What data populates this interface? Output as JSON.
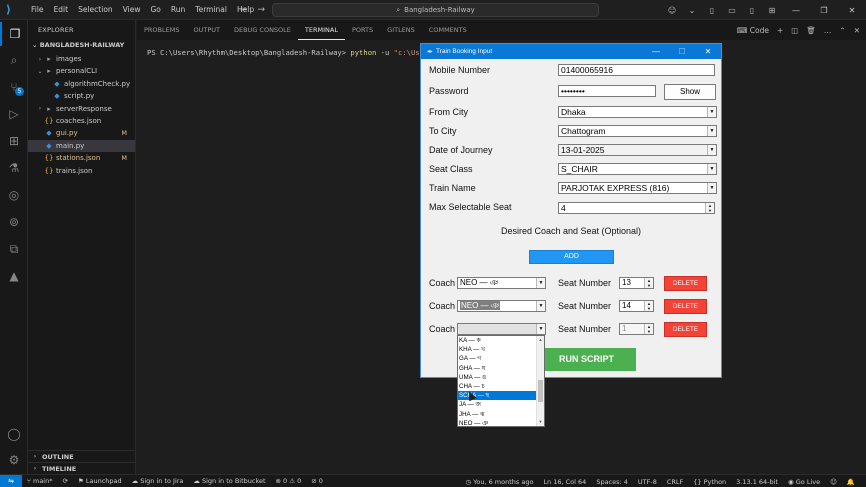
{
  "titlebar": {
    "menu": [
      "File",
      "Edit",
      "Selection",
      "View",
      "Go",
      "Run",
      "Terminal",
      "Help"
    ],
    "search_text": "Bangladesh-Railway"
  },
  "sidebar": {
    "title": "EXPLORER",
    "root": "BANGLADESH-RAILWAY",
    "items": [
      {
        "label": "images",
        "kind": "folder",
        "indent": 1,
        "expanded": false
      },
      {
        "label": "personalCLI",
        "kind": "folder",
        "indent": 1,
        "expanded": true
      },
      {
        "label": "algorithmCheck.py",
        "kind": "py",
        "indent": 2
      },
      {
        "label": "script.py",
        "kind": "py",
        "indent": 2
      },
      {
        "label": "serverResponse",
        "kind": "folder",
        "indent": 1,
        "expanded": false
      },
      {
        "label": "coaches.json",
        "kind": "json",
        "indent": 1
      },
      {
        "label": "gui.py",
        "kind": "py",
        "indent": 1,
        "modified": "M"
      },
      {
        "label": "main.py",
        "kind": "py",
        "indent": 1,
        "selected": true
      },
      {
        "label": "stations.json",
        "kind": "json",
        "indent": 1,
        "modified": "M"
      },
      {
        "label": "trains.json",
        "kind": "json",
        "indent": 1
      }
    ],
    "outline": "OUTLINE",
    "timeline": "TIMELINE"
  },
  "panel": {
    "tabs": [
      "PROBLEMS",
      "OUTPUT",
      "DEBUG CONSOLE",
      "TERMINAL",
      "PORTS",
      "GITLENS",
      "COMMENTS"
    ],
    "active_tab": "TERMINAL",
    "shell_label": "Code",
    "prompt": "PS C:\\Users\\Rhythm\\Desktop\\Bangladesh-Railway>",
    "command": "python",
    "args": " -u ",
    "path_arg": "\"c:\\Users\\"
  },
  "statusbar": {
    "branch": "main*",
    "sync": "⟳",
    "errors": "⊗ 0 ⚠ 0",
    "launchpad": "Launchpad",
    "jira": "Sign in to Jira",
    "bitbucket": "Sign in to Bitbucket",
    "ports": "⊘ 0",
    "blame": "You, 6 months ago",
    "position": "Ln 16, Col 64",
    "spaces": "Spaces: 4",
    "encoding": "UTF-8",
    "eol": "CRLF",
    "language": "Python",
    "interpreter": "3.13.1 64-bit",
    "golive": "Go Live"
  },
  "form": {
    "window_title": "Train Booking Input",
    "labels": {
      "mobile": "Mobile Number",
      "password": "Password",
      "from_city": "From City",
      "to_city": "To City",
      "date": "Date of Journey",
      "seat_class": "Seat Class",
      "train_name": "Train Name",
      "max_seat": "Max Selectable Seat",
      "desired": "Desired Coach and Seat (Optional)",
      "coach": "Coach",
      "seat_number": "Seat Number"
    },
    "values": {
      "mobile": "01400065916",
      "password": "••••••••",
      "from_city": "Dhaka",
      "to_city": "Chattogram",
      "date": "13-01-2025",
      "seat_class": "S_CHAIR",
      "train_name": "PARJOTAK EXPRESS (816)",
      "max_seat": "4"
    },
    "buttons": {
      "show": "Show",
      "add": "ADD",
      "delete": "DELETE",
      "run": "RUN SCRIPT"
    },
    "coach_rows": [
      {
        "coach": "NEO — ঞ",
        "seat": "13",
        "highlighted": false,
        "disabled": false
      },
      {
        "coach": "NEO — ঞ",
        "seat": "14",
        "highlighted": true,
        "disabled": false
      },
      {
        "coach": "",
        "seat": "1",
        "highlighted": false,
        "disabled": true
      }
    ],
    "coach_options": [
      "KA — ক",
      "KHA — খ",
      "GA — গ",
      "GHA — ঘ",
      "UMA — ঙ",
      "CHA — চ",
      "SCHA — ছ",
      "JA — জ",
      "JHA — ঝ",
      "NEO — ঞ"
    ],
    "coach_options_selected": 6
  }
}
